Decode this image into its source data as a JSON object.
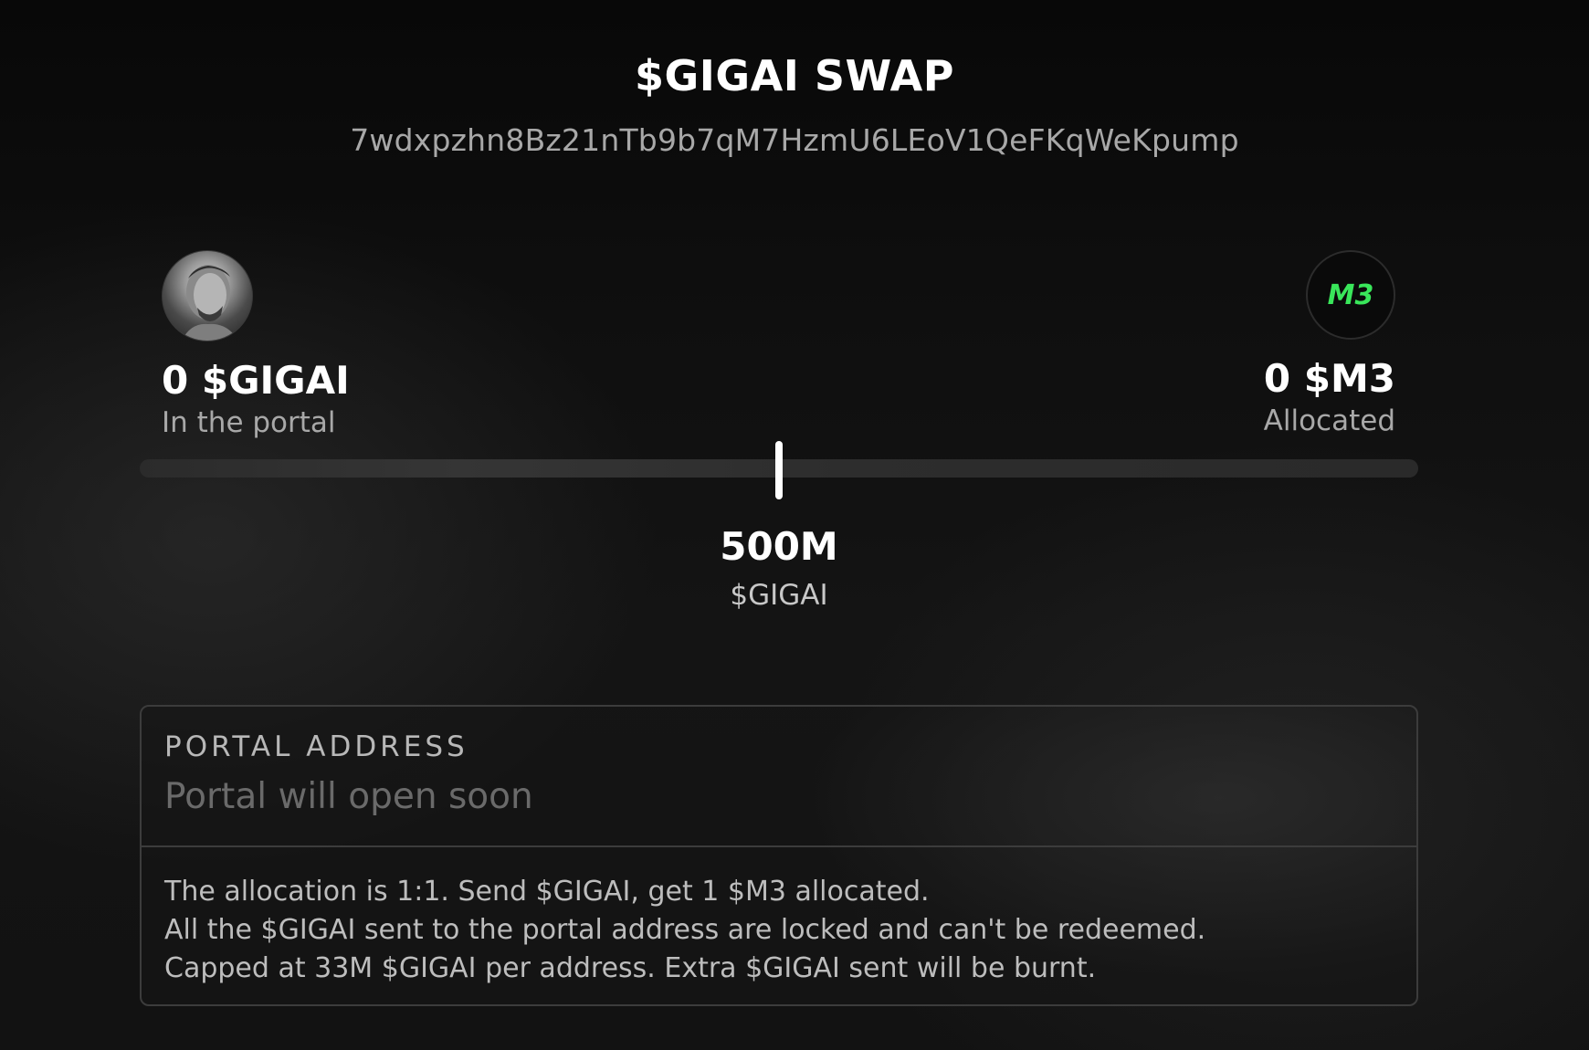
{
  "header": {
    "title": "$GIGAI SWAP",
    "contract_address": "7wdxpzhn8Bz21nTb9b7qM7HzmU6LEoV1QeFKqWeKpump"
  },
  "source_token": {
    "amount": "0 $GIGAI",
    "caption": "In the portal",
    "icon": "gigai-avatar-icon"
  },
  "target_token": {
    "amount": "0 $M3",
    "caption": "Allocated",
    "icon": "m3-logo-icon",
    "logo_text": "M3",
    "logo_color": "#39e65a"
  },
  "slider": {
    "value": "500M",
    "unit": "$GIGAI",
    "position_fraction": 0.5
  },
  "portal": {
    "label": "PORTAL ADDRESS",
    "placeholder": "Portal will open soon",
    "info": [
      "The allocation is 1:1. Send $GIGAI, get 1 $M3 allocated.",
      "All the $GIGAI sent to the portal address are locked and can't be redeemed.",
      "Capped at 33M $GIGAI per address. Extra $GIGAI sent will be burnt."
    ]
  }
}
